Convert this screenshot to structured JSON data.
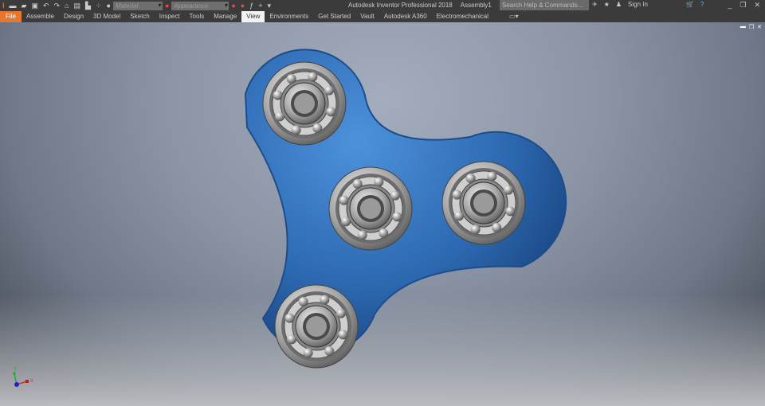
{
  "app": {
    "title": "Autodesk Inventor Professional 2018",
    "document": "Assembly1"
  },
  "qat": {
    "material_placeholder": "Material",
    "appearance_placeholder": "Appearance",
    "icons": [
      "inventor-logo-icon",
      "new-icon",
      "open-icon",
      "save-icon",
      "undo-icon",
      "redo-icon",
      "home-icon",
      "update-icon",
      "select-icon",
      "color-wheel-icon",
      "adjust-icon",
      "clear-icon",
      "fx-icon",
      "plus-icon",
      "customize-icon"
    ]
  },
  "search": {
    "placeholder": "Search Help & Commands..."
  },
  "account": {
    "sign_in": "Sign In"
  },
  "tabs": [
    {
      "label": "File"
    },
    {
      "label": "Assemble"
    },
    {
      "label": "Design"
    },
    {
      "label": "3D Model"
    },
    {
      "label": "Sketch"
    },
    {
      "label": "Inspect"
    },
    {
      "label": "Tools"
    },
    {
      "label": "Manage"
    },
    {
      "label": "View",
      "active": true
    },
    {
      "label": "Environments"
    },
    {
      "label": "Get Started"
    },
    {
      "label": "Vault"
    },
    {
      "label": "Autodesk A360"
    },
    {
      "label": "Electromechanical"
    }
  ],
  "triad": {
    "x": "X",
    "y": "Y"
  },
  "colors": {
    "accent": "#e8772e",
    "body": "#2f6eb8",
    "ribbon": "#3b3b3b"
  }
}
